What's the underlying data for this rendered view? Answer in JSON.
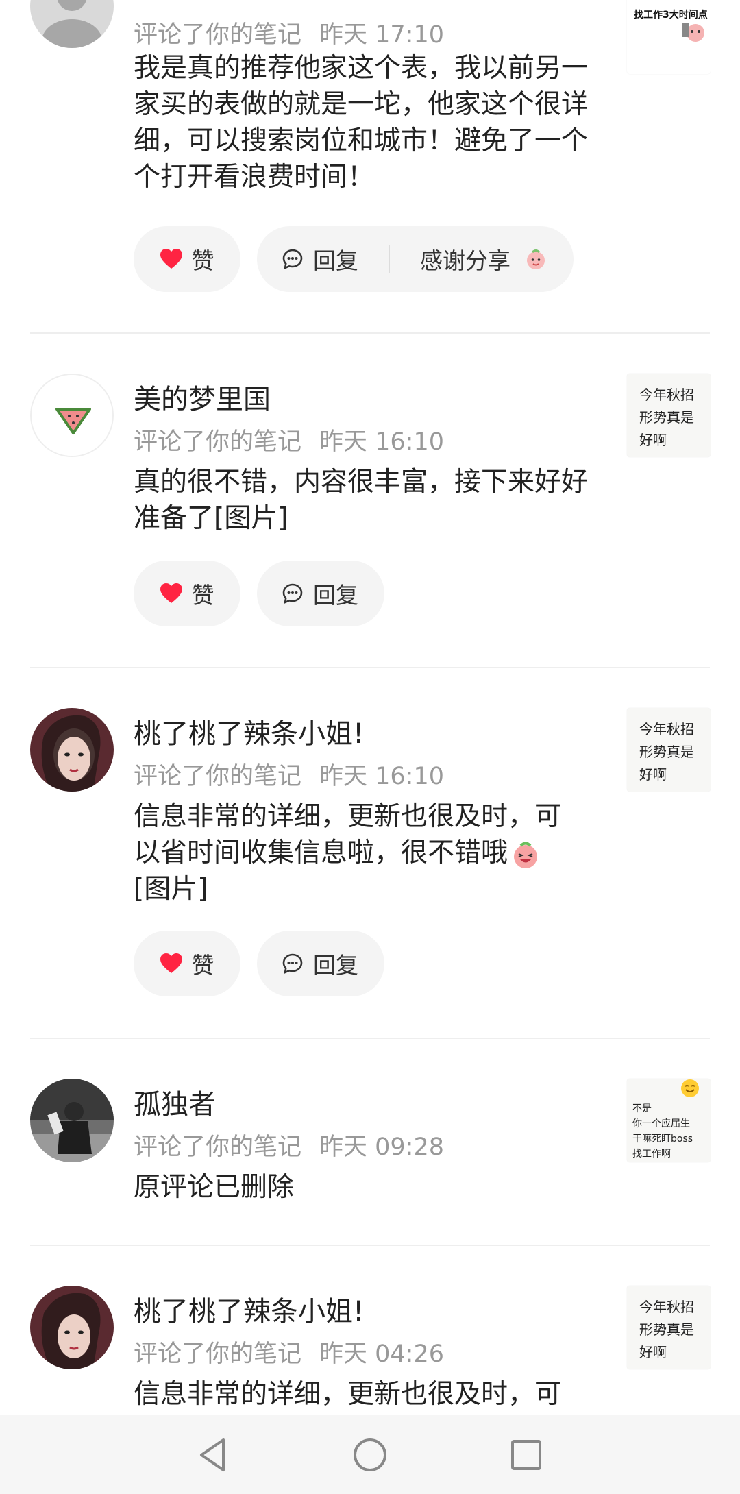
{
  "notifications": [
    {
      "meta_text": "评论了你的笔记",
      "time": "昨天 17:10",
      "content": "我是真的推荐他家这个表，我以前另一家买的表做的就是一坨，他家这个很详细，可以搜索岗位和城市！避免了一个个打开看浪费时间！",
      "like_label": "赞",
      "reply_label": "回复",
      "thanks_label": "感谢分享",
      "thumb_text": "找工作3大时间点"
    },
    {
      "name": "美的梦里国",
      "meta_text": "评论了你的笔记",
      "time": "昨天 16:10",
      "content": "真的很不错，内容很丰富，接下来好好准备了[图片]",
      "like_label": "赞",
      "reply_label": "回复",
      "thumb_lines": [
        "今年秋招",
        "形势真是",
        "好啊"
      ]
    },
    {
      "name": "桃了桃了辣条小姐!",
      "meta_text": "评论了你的笔记",
      "time": "昨天 16:10",
      "content_line1": "信息非常的详细，更新也很及时，可",
      "content_line2": "以省时间收集信息啦，很不错哦",
      "content_line3": "[图片]",
      "like_label": "赞",
      "reply_label": "回复",
      "thumb_lines": [
        "今年秋招",
        "形势真是",
        "好啊"
      ]
    },
    {
      "name": "孤独者",
      "meta_text": "评论了你的笔记",
      "time": "昨天 09:28",
      "content": "原评论已删除",
      "thumb_lines": [
        "不是",
        "你一个应届生",
        "干嘛死盯boss",
        "找工作啊"
      ]
    },
    {
      "name": "桃了桃了辣条小姐!",
      "meta_text": "评论了你的笔记",
      "time": "昨天 04:26",
      "content": "信息非常的详细，更新也很及时，可",
      "thumb_lines": [
        "今年秋招",
        "形势真是",
        "好啊"
      ]
    }
  ],
  "nav": {
    "back_icon": "triangle-back-icon",
    "home_icon": "circle-home-icon",
    "recents_icon": "square-recents-icon"
  },
  "colors": {
    "like_red": "#ff2442",
    "meta_gray": "#999999",
    "pill_bg": "#f4f4f4"
  }
}
